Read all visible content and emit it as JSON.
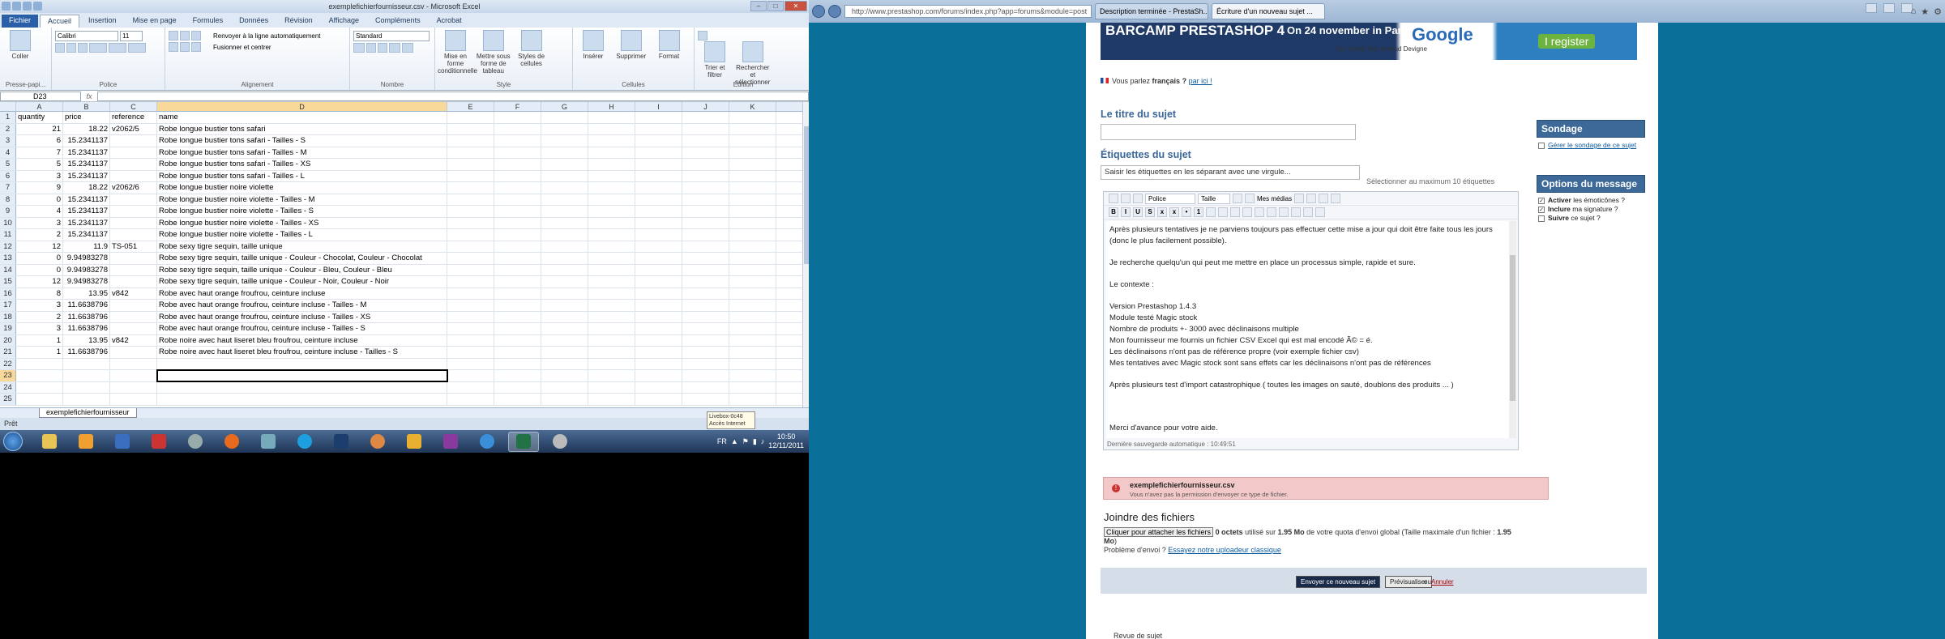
{
  "excel": {
    "title": "exemplefichierfournisseur.csv - Microsoft Excel",
    "tabs": [
      "Fichier",
      "Accueil",
      "Insertion",
      "Mise en page",
      "Formules",
      "Données",
      "Révision",
      "Affichage",
      "Compléments",
      "Acrobat"
    ],
    "ribbon": {
      "paste": "Coller",
      "font_name": "Calibri",
      "font_size": "11",
      "wrap": "Renvoyer à la ligne automatiquement",
      "merge": "Fusionner et centrer",
      "number_format": "Standard",
      "cond_format": "Mise en forme conditionnelle",
      "table_format": "Mettre sous forme de tableau",
      "cell_styles": "Styles de cellules",
      "insert": "Insérer",
      "delete": "Supprimer",
      "format": "Format",
      "sort": "Trier et filtrer",
      "find": "Rechercher et sélectionner",
      "groups": [
        "Presse-papi...",
        "Police",
        "Alignement",
        "Nombre",
        "Style",
        "Cellules",
        "Édition"
      ]
    },
    "namebox": "D23",
    "fx": "fx",
    "columns": [
      "A",
      "B",
      "C",
      "D",
      "E",
      "F",
      "G",
      "H",
      "I",
      "J",
      "K"
    ],
    "rows": [
      [
        "1",
        "quantity",
        "price",
        "reference",
        "name"
      ],
      [
        "2",
        "21",
        "18.22",
        "v2062/5",
        "Robe longue bustier tons safari"
      ],
      [
        "3",
        "6",
        "15.2341137",
        "",
        "Robe longue bustier tons safari - Tailles - S"
      ],
      [
        "4",
        "7",
        "15.2341137",
        "",
        "Robe longue bustier tons safari - Tailles - M"
      ],
      [
        "5",
        "5",
        "15.2341137",
        "",
        "Robe longue bustier tons safari - Tailles - XS"
      ],
      [
        "6",
        "3",
        "15.2341137",
        "",
        "Robe longue bustier tons safari - Tailles - L"
      ],
      [
        "7",
        "9",
        "18.22",
        "v2062/6",
        "Robe longue bustier noire violette"
      ],
      [
        "8",
        "0",
        "15.2341137",
        "",
        "Robe longue bustier noire violette - Tailles - M"
      ],
      [
        "9",
        "4",
        "15.2341137",
        "",
        "Robe longue bustier noire violette - Tailles - S"
      ],
      [
        "10",
        "3",
        "15.2341137",
        "",
        "Robe longue bustier noire violette - Tailles - XS"
      ],
      [
        "11",
        "2",
        "15.2341137",
        "",
        "Robe longue bustier noire violette - Tailles - L"
      ],
      [
        "12",
        "12",
        "11.9",
        "TS-051",
        "Robe sexy tigre sequin, taille unique"
      ],
      [
        "13",
        "0",
        "9.94983278",
        "",
        "Robe sexy tigre sequin, taille unique - Couleur - Chocolat, Couleur - Chocolat"
      ],
      [
        "14",
        "0",
        "9.94983278",
        "",
        "Robe sexy tigre sequin, taille unique - Couleur - Bleu, Couleur - Bleu"
      ],
      [
        "15",
        "12",
        "9.94983278",
        "",
        "Robe sexy tigre sequin, taille unique - Couleur - Noir, Couleur - Noir"
      ],
      [
        "16",
        "8",
        "13.95",
        "v842",
        "Robe avec haut orange froufrou, ceinture incluse"
      ],
      [
        "17",
        "3",
        "11.6638796",
        "",
        "Robe avec haut orange froufrou, ceinture incluse - Tailles - M"
      ],
      [
        "18",
        "2",
        "11.6638796",
        "",
        "Robe avec haut orange froufrou, ceinture incluse - Tailles - XS"
      ],
      [
        "19",
        "3",
        "11.6638796",
        "",
        "Robe avec haut orange froufrou, ceinture incluse - Tailles - S"
      ],
      [
        "20",
        "1",
        "13.95",
        "v842",
        "Robe noire avec haut liseret bleu froufrou, ceinture incluse"
      ],
      [
        "21",
        "1",
        "11.6638796",
        "",
        "Robe noire avec haut liseret bleu froufrou, ceinture incluse - Tailles - S"
      ],
      [
        "22",
        "",
        "",
        "",
        ""
      ],
      [
        "23",
        "",
        "",
        "",
        ""
      ],
      [
        "24",
        "",
        "",
        "",
        ""
      ],
      [
        "25",
        "",
        "",
        "",
        ""
      ]
    ],
    "sheet_tab": "exemplefichierfournisseur",
    "status": "Prêt",
    "tooltip_line1": "Livebox-0c48",
    "tooltip_line2": "Accès Internet"
  },
  "taskbar": {
    "lang": "FR",
    "time": "10:50",
    "date": "12/11/2011"
  },
  "browser": {
    "url": "http://www.prestashop.com/forums/index.php?app=forums&module=post",
    "tabs": [
      "Description terminée - PrestaSh...",
      "Écriture d'un nouveau sujet ..."
    ],
    "banner": {
      "event": "BARCAMP PRESTASHOP 4",
      "date": "On 24 november in Paris",
      "guest": "Our Guest Star Arnaud Devigne",
      "google": "Google",
      "register": "I register"
    },
    "lang_prompt": "Vous parlez",
    "lang_value": "français ?",
    "lang_link": "par ici !",
    "title_heading": "Le titre du sujet",
    "tags_heading": "Étiquettes du sujet",
    "tags_placeholder": "Saisir les étiquettes en les séparant avec une virgule...",
    "tags_note": "Sélectionner au maximum 10 étiquettes",
    "editor": {
      "font": "Police",
      "size": "Taille",
      "media": "Mes médias",
      "lines": [
        "Après plusieurs tentatives je ne parviens toujours pas effectuer cette mise a jour qui doit être faite tous les jours (donc le plus facilement possible).",
        "",
        "Je recherche quelqu'un qui peut me mettre en place un processus simple, rapide et sure.",
        "",
        "Le contexte :",
        "",
        "Version Prestashop 1.4.3",
        "Module testé Magic stock",
        "Nombre de produits +- 3000 avec déclinaisons multiple",
        "Mon fournisseur me fournis un fichier CSV Excel  qui est mal encodé  Ã© = é.",
        "Les déclinaisons n'ont pas de référence propre (voir exemple fichier csv)",
        "Mes tentatives avec Magic stock sont sans effets car les déclinaisons n'ont pas de références",
        "",
        "Après plusieurs test d'import catastrophique  ( toutes les images on sauté, doublons des produits ... )",
        "",
        "",
        "",
        "Merci d'avance pour votre aide."
      ],
      "autosave": "Dernière sauvegarde automatique : 10:49:51"
    },
    "error": {
      "file": "exemplefichierfournisseur.csv",
      "msg": "Vous n'avez pas la permission d'envoyer ce type de fichier."
    },
    "join_heading": "Joindre des fichiers",
    "attach_button": "Cliquer pour attacher les fichiers",
    "attach_used": "0 octets",
    "attach_text1": "utilisé sur",
    "attach_quota": "1.95 Mo",
    "attach_text2": "de votre quota d'envoi global (Taille maximale d'un fichier :",
    "attach_max": "1.95 Mo",
    "attach_close": ")",
    "problem": "Problème d'envoi ?",
    "problem_link": "Essayez notre uploadeur classique",
    "submit": "Envoyer ce nouveau sujet",
    "preview": "Prévisualiser",
    "or": "ou",
    "cancel": "Annuler",
    "sidebar": {
      "sondage": "Sondage",
      "sondage_link": "Gérer le sondage de ce sujet",
      "options": "Options du message",
      "opt1_b": "Activer",
      "opt1": "les émoticônes ?",
      "opt2_b": "Inclure",
      "opt2": "ma signature ?",
      "opt3_b": "Suivre",
      "opt3": "ce sujet ?"
    },
    "bottom": "Revue de sujet"
  }
}
